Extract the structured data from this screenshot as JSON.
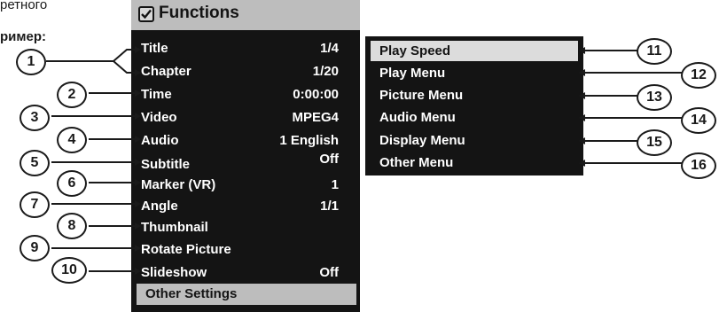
{
  "captions": {
    "top": "ретного",
    "example": "ример:"
  },
  "functions_menu": {
    "title": "Functions",
    "icon": "checkbox-icon",
    "items": [
      {
        "label": "Title",
        "value": "1/4"
      },
      {
        "label": "Chapter",
        "value": "1/20"
      },
      {
        "label": "Time",
        "value": "0:00:00"
      },
      {
        "label": "Video",
        "value": "MPEG4"
      },
      {
        "label": "Audio",
        "value": "1 English"
      },
      {
        "label": "Subtitle",
        "value": "Off"
      },
      {
        "label": "Marker (VR)",
        "value": "1"
      },
      {
        "label": "Angle",
        "value": "1/1"
      },
      {
        "label": "Thumbnail",
        "value": ""
      },
      {
        "label": "Rotate Picture",
        "value": ""
      },
      {
        "label": "Slideshow",
        "value": "Off"
      }
    ],
    "footer": "Other Settings"
  },
  "settings_menu": {
    "items": [
      "Play Speed",
      "Play Menu",
      "Picture Menu",
      "Audio Menu",
      "Display Menu",
      "Other Menu"
    ],
    "selected": "Play Speed"
  },
  "callouts": [
    "1",
    "2",
    "3",
    "4",
    "5",
    "6",
    "7",
    "8",
    "9",
    "10",
    "11",
    "12",
    "13",
    "14",
    "15",
    "16"
  ],
  "colors": {
    "panel": "#141414",
    "header": "#bdbdbd",
    "highlight": "#dcdcdc",
    "text": "#ffffff"
  }
}
